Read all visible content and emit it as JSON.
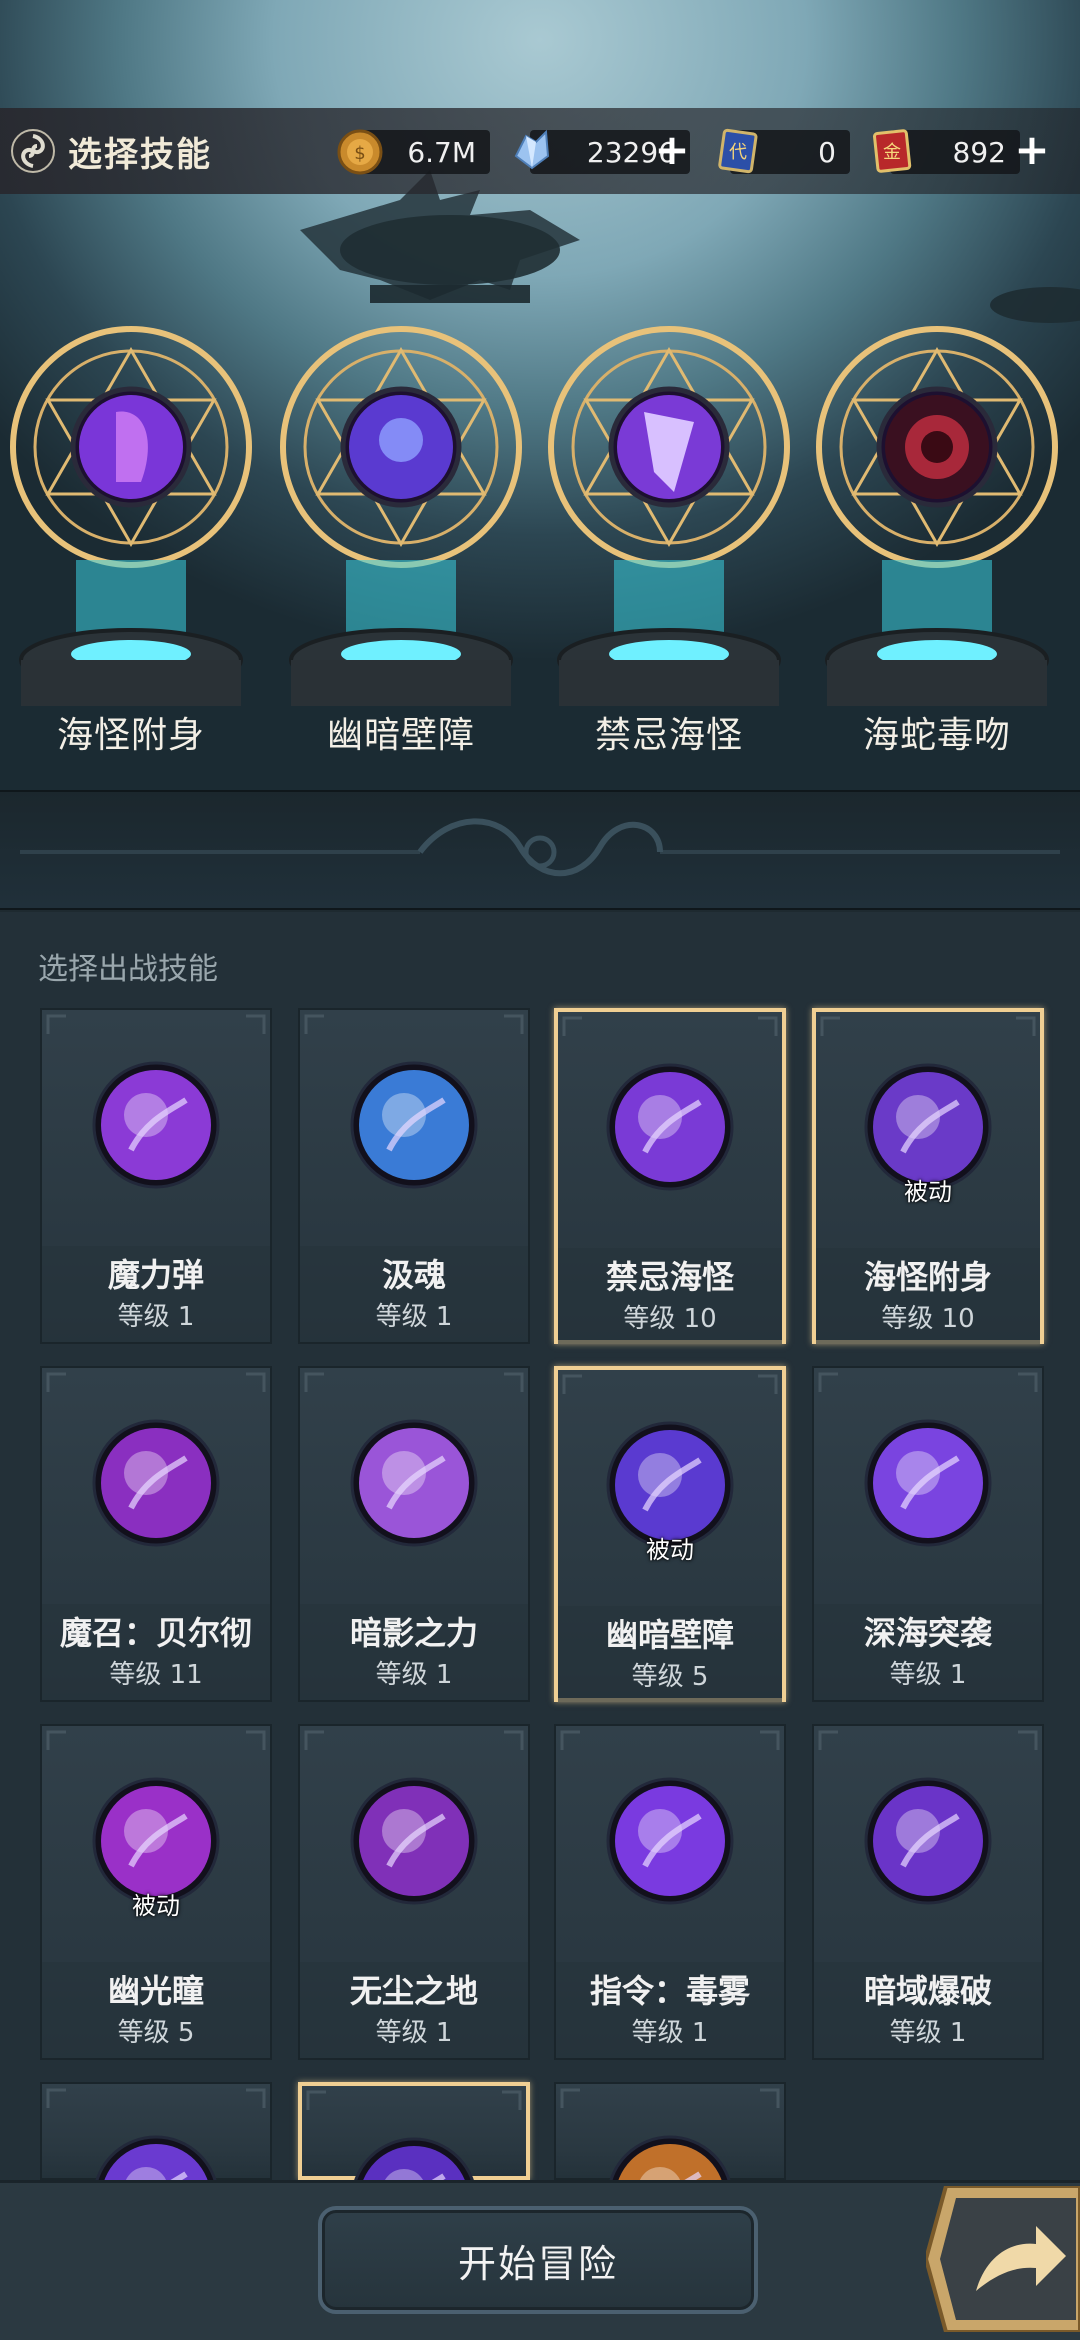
{
  "header": {
    "title": "选择技能",
    "resources": [
      {
        "name": "gold-coin",
        "value": "6.7M"
      },
      {
        "name": "crystal",
        "value": "23296",
        "has_plus": true
      },
      {
        "name": "代-ticket",
        "value": "0"
      },
      {
        "name": "金-ticket",
        "value": "892",
        "has_plus": true
      }
    ]
  },
  "selected_skills": [
    {
      "label": "海怪附身",
      "icon": "kraken-possession-icon"
    },
    {
      "label": "幽暗壁障",
      "icon": "dark-barrier-icon"
    },
    {
      "label": "禁忌海怪",
      "icon": "forbidden-kraken-icon"
    },
    {
      "label": "海蛇毒吻",
      "icon": "sea-serpent-bite-icon"
    }
  ],
  "panel": {
    "title": "选择出战技能"
  },
  "skills": [
    {
      "name": "魔力弹",
      "level": "等级 1",
      "passive": "",
      "selected": false,
      "color": "#8b3ad6"
    },
    {
      "name": "汲魂",
      "level": "等级 1",
      "passive": "",
      "selected": false,
      "color": "#3a7bd6"
    },
    {
      "name": "禁忌海怪",
      "level": "等级 10",
      "passive": "",
      "selected": true,
      "color": "#7a3ad6"
    },
    {
      "name": "海怪附身",
      "level": "等级 10",
      "passive": "被动",
      "selected": true,
      "color": "#6a3ac8"
    },
    {
      "name": "魔召：贝尔彻",
      "level": "等级 11",
      "passive": "",
      "selected": false,
      "color": "#8a2fc0"
    },
    {
      "name": "暗影之力",
      "level": "等级 1",
      "passive": "",
      "selected": false,
      "color": "#9a55d8"
    },
    {
      "name": "幽暗壁障",
      "level": "等级 5",
      "passive": "被动",
      "selected": true,
      "color": "#5a3ad0"
    },
    {
      "name": "深海突袭",
      "level": "等级 1",
      "passive": "",
      "selected": false,
      "color": "#7a44e0"
    },
    {
      "name": "幽光瞳",
      "level": "等级 5",
      "passive": "被动",
      "selected": false,
      "color": "#9a30c8"
    },
    {
      "name": "无尘之地",
      "level": "等级 1",
      "passive": "",
      "selected": false,
      "color": "#8030b8"
    },
    {
      "name": "指令：毒雾",
      "level": "等级 1",
      "passive": "",
      "selected": false,
      "color": "#7a3ae0"
    },
    {
      "name": "暗域爆破",
      "level": "等级 1",
      "passive": "",
      "selected": false,
      "color": "#6a34c8"
    },
    {
      "name": "",
      "level": "",
      "passive": "",
      "selected": false,
      "color": "#6a3ad0"
    },
    {
      "name": "",
      "level": "",
      "passive": "",
      "selected": true,
      "color": "#5a30c0"
    },
    {
      "name": "",
      "level": "",
      "passive": "",
      "selected": false,
      "color": "#c0702a"
    }
  ],
  "footer": {
    "start_label": "开始冒险"
  }
}
